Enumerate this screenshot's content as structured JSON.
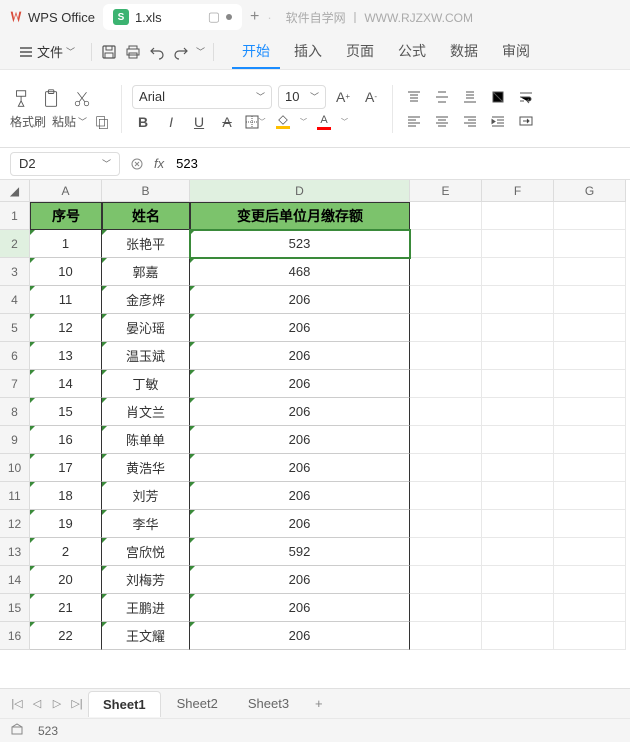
{
  "titlebar": {
    "app_name": "WPS Office",
    "file_name": "1.xls",
    "watermark": "软件自学网 丨 WWW.RJZXW.COM"
  },
  "menubar": {
    "file_label": "文件",
    "tabs": [
      "开始",
      "插入",
      "页面",
      "公式",
      "数据",
      "审阅"
    ],
    "active_tab": 0
  },
  "toolbar": {
    "format_painter": "格式刷",
    "paste": "粘贴",
    "font_name": "Arial",
    "font_size": "10"
  },
  "namebox": {
    "cell_ref": "D2",
    "formula_value": "523"
  },
  "columns": [
    "A",
    "B",
    "D",
    "E",
    "F",
    "G"
  ],
  "headers": {
    "col_a": "序号",
    "col_b": "姓名",
    "col_d": "变更后单位月缴存额"
  },
  "rows": [
    {
      "n": 1,
      "a": "1",
      "b": "张艳平",
      "d": "523"
    },
    {
      "n": 2,
      "a": "10",
      "b": "郭嘉",
      "d": "468"
    },
    {
      "n": 3,
      "a": "11",
      "b": "金彦烨",
      "d": "206"
    },
    {
      "n": 4,
      "a": "12",
      "b": "晏沁瑶",
      "d": "206"
    },
    {
      "n": 5,
      "a": "13",
      "b": "温玉斌",
      "d": "206"
    },
    {
      "n": 6,
      "a": "14",
      "b": "丁敏",
      "d": "206"
    },
    {
      "n": 7,
      "a": "15",
      "b": "肖文兰",
      "d": "206"
    },
    {
      "n": 8,
      "a": "16",
      "b": "陈单单",
      "d": "206"
    },
    {
      "n": 9,
      "a": "17",
      "b": "黄浩华",
      "d": "206"
    },
    {
      "n": 10,
      "a": "18",
      "b": "刘芳",
      "d": "206"
    },
    {
      "n": 11,
      "a": "19",
      "b": "李华",
      "d": "206"
    },
    {
      "n": 12,
      "a": "2",
      "b": "宫欣悦",
      "d": "592"
    },
    {
      "n": 13,
      "a": "20",
      "b": "刘梅芳",
      "d": "206"
    },
    {
      "n": 14,
      "a": "21",
      "b": "王鹏进",
      "d": "206"
    },
    {
      "n": 15,
      "a": "22",
      "b": "王文耀",
      "d": "206"
    }
  ],
  "sheet_tabs": [
    "Sheet1",
    "Sheet2",
    "Sheet3"
  ],
  "active_sheet": 0,
  "statusbar": {
    "value": "523"
  }
}
